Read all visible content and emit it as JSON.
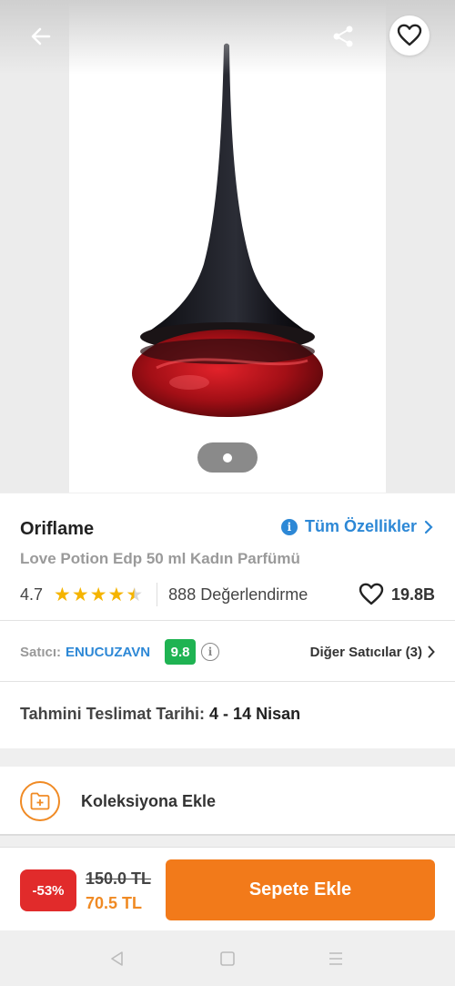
{
  "product": {
    "brand": "Oriflame",
    "all_features_label": "Tüm Özellikler",
    "name": "Love Potion Edp 50 ml Kadın Parfümü",
    "rating": "4.7",
    "rating_stars": 4.5,
    "review_count_label": "888 Değerlendirme",
    "favorite_count": "19.8B",
    "image_page_count": 1,
    "image_current_page": 1
  },
  "seller": {
    "label": "Satıcı:",
    "name": "ENUCUZAVN",
    "score": "9.8",
    "other_sellers_label": "Diğer Satıcılar (3)"
  },
  "delivery": {
    "label": "Tahmini Teslimat Tarihi:",
    "value": "4 - 14 Nisan"
  },
  "collection": {
    "label": "Koleksiyona Ekle"
  },
  "buybar": {
    "discount": "-53%",
    "old_price": "150.0 TL",
    "new_price": "70.5 TL",
    "add_to_cart_label": "Sepete Ekle"
  },
  "icons": {
    "back": "arrow-left-icon",
    "share": "share-icon",
    "favorite": "heart-outline-icon",
    "info": "info-icon",
    "chevron": "chevron-right-icon",
    "collection": "folder-plus-icon",
    "nav_back": "triangle-back-icon",
    "nav_home": "square-home-icon",
    "nav_menu": "menu-lines-icon"
  },
  "colors": {
    "accent_orange": "#f27a1a",
    "link_blue": "#2d88d6",
    "score_green": "#1fb352",
    "discount_red": "#e12b2b",
    "star_yellow": "#f5b400"
  }
}
